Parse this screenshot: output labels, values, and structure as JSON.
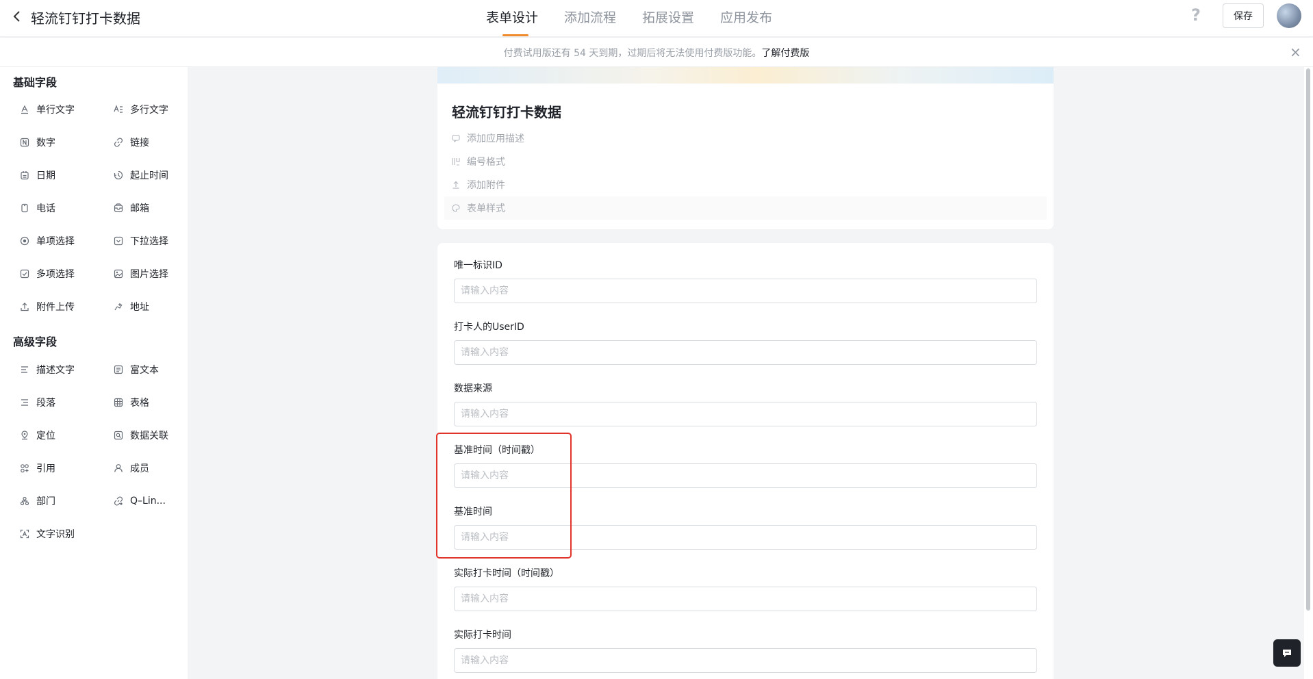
{
  "header": {
    "back_icon": "chevron-left-icon",
    "title": "轻流钉钉打卡数据",
    "tabs": [
      {
        "label": "表单设计",
        "active": true
      },
      {
        "label": "添加流程",
        "active": false
      },
      {
        "label": "拓展设置",
        "active": false
      },
      {
        "label": "应用发布",
        "active": false
      }
    ],
    "help_icon": "?",
    "save_label": "保存"
  },
  "banner": {
    "text": "付费试用版还有 54 天到期，过期后将无法使用付费版功能。",
    "link": "了解付费版",
    "close_icon": "×"
  },
  "sidebar": {
    "basic_title": "基础字段",
    "basic_fields": [
      {
        "label": "单行文字",
        "icon": "single-line-text-icon"
      },
      {
        "label": "多行文字",
        "icon": "multi-line-text-icon"
      },
      {
        "label": "数字",
        "icon": "number-icon"
      },
      {
        "label": "链接",
        "icon": "link-icon"
      },
      {
        "label": "日期",
        "icon": "calendar-icon"
      },
      {
        "label": "起止时间",
        "icon": "time-range-icon"
      },
      {
        "label": "电话",
        "icon": "phone-icon"
      },
      {
        "label": "邮箱",
        "icon": "mail-icon"
      },
      {
        "label": "单项选择",
        "icon": "radio-icon"
      },
      {
        "label": "下拉选择",
        "icon": "dropdown-icon"
      },
      {
        "label": "多项选择",
        "icon": "checkbox-icon"
      },
      {
        "label": "图片选择",
        "icon": "image-icon"
      },
      {
        "label": "附件上传",
        "icon": "upload-icon"
      },
      {
        "label": "地址",
        "icon": "address-icon"
      }
    ],
    "advanced_title": "高级字段",
    "advanced_fields": [
      {
        "label": "描述文字",
        "icon": "description-icon"
      },
      {
        "label": "富文本",
        "icon": "rich-text-icon"
      },
      {
        "label": "段落",
        "icon": "paragraph-icon"
      },
      {
        "label": "表格",
        "icon": "table-icon"
      },
      {
        "label": "定位",
        "icon": "location-icon"
      },
      {
        "label": "数据关联",
        "icon": "data-link-icon"
      },
      {
        "label": "引用",
        "icon": "reference-icon"
      },
      {
        "label": "成员",
        "icon": "member-icon"
      },
      {
        "label": "部门",
        "icon": "department-icon"
      },
      {
        "label": "Q–Lin...",
        "icon": "q-linker-icon"
      },
      {
        "label": "文字识别",
        "icon": "ocr-icon"
      }
    ]
  },
  "form_header": {
    "title": "轻流钉钉打卡数据",
    "meta": [
      {
        "label": "添加应用描述",
        "icon": "comment-icon"
      },
      {
        "label": "编号格式",
        "icon": "numbering-icon"
      },
      {
        "label": "添加附件",
        "icon": "attachment-upload-icon"
      },
      {
        "label": "表单样式",
        "icon": "palette-icon"
      }
    ]
  },
  "form": {
    "fields": [
      {
        "label": "唯一标识ID",
        "placeholder": "请输入内容"
      },
      {
        "label": "打卡人的UserID",
        "placeholder": "请输入内容"
      },
      {
        "label": "数据来源",
        "placeholder": "请输入内容"
      },
      {
        "label": "基准时间（时间戳）",
        "placeholder": "请输入内容"
      },
      {
        "label": "基准时间",
        "placeholder": "请输入内容"
      },
      {
        "label": "实际打卡时间（时间戳）",
        "placeholder": "请输入内容"
      },
      {
        "label": "实际打卡时间",
        "placeholder": "请输入内容"
      }
    ]
  },
  "colors": {
    "accent": "#f08c2e",
    "highlight_box": "#e0342a"
  }
}
